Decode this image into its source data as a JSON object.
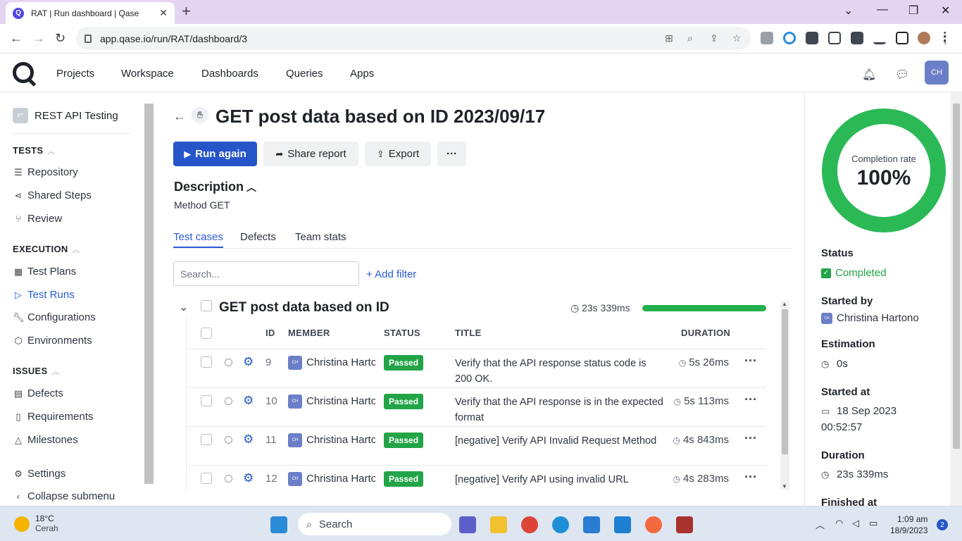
{
  "browser": {
    "tab_title": "RAT | Run dashboard | Qase",
    "tab_favicon": "Q",
    "url": "app.qase.io/run/RAT/dashboard/3"
  },
  "app": {
    "nav": [
      "Projects",
      "Workspace",
      "Dashboards",
      "Queries",
      "Apps"
    ],
    "user_initials": "CH"
  },
  "sidebar": {
    "project_badge": "RT",
    "project_name": "REST API Testing",
    "sections": {
      "tests": "TESTS",
      "execution": "EXECUTION",
      "issues": "ISSUES"
    },
    "items": [
      {
        "label": "Repository",
        "icon": "list-icon"
      },
      {
        "label": "Shared Steps",
        "icon": "share-icon"
      },
      {
        "label": "Review",
        "icon": "pull-request-icon"
      },
      {
        "label": "Test Plans",
        "icon": "table-icon"
      },
      {
        "label": "Test Runs",
        "icon": "play-icon"
      },
      {
        "label": "Configurations",
        "icon": "wrench-icon"
      },
      {
        "label": "Environments",
        "icon": "cube-icon"
      },
      {
        "label": "Defects",
        "icon": "defect-icon"
      },
      {
        "label": "Requirements",
        "icon": "document-icon"
      },
      {
        "label": "Milestones",
        "icon": "milestone-icon"
      },
      {
        "label": "Settings",
        "icon": "gear-icon"
      },
      {
        "label": "Collapse submenu",
        "icon": "chevron-left-icon"
      }
    ]
  },
  "run": {
    "title": "GET post data based on ID 2023/09/17",
    "buttons": {
      "run_again": "Run again",
      "share_report": "Share report",
      "export": "Export",
      "more": "···"
    },
    "description_heading": "Description",
    "description_text": "Method GET",
    "tabs": [
      "Test cases",
      "Defects",
      "Team stats"
    ],
    "search_placeholder": "Search...",
    "add_filter": "+ Add filter",
    "suite": {
      "name": "GET post data based on ID",
      "time": "23s 339ms",
      "progress": 1.0
    },
    "columns": {
      "id": "ID",
      "member": "MEMBER",
      "status": "STATUS",
      "title": "TITLE",
      "duration": "DURATION"
    },
    "rows": [
      {
        "id": "9",
        "member_initials": "CH",
        "member": "Christina Hartono",
        "status": "Passed",
        "title": "Verify that the API response status code is 200 OK.",
        "duration": "5s 26ms"
      },
      {
        "id": "10",
        "member_initials": "CH",
        "member": "Christina Hartono",
        "status": "Passed",
        "title": "Verify that the API response is in the expected format",
        "duration": "5s 113ms"
      },
      {
        "id": "11",
        "member_initials": "CH",
        "member": "Christina Hartono",
        "status": "Passed",
        "title": "[negative] Verify API Invalid Request Method",
        "duration": "4s 843ms"
      },
      {
        "id": "12",
        "member_initials": "CH",
        "member": "Christina Hartono",
        "status": "Passed",
        "title": "[negative] Verify API using invalid URL",
        "duration": "4s 283ms"
      }
    ]
  },
  "summary": {
    "completion_label": "Completion rate",
    "completion_value": "100%",
    "completion_fraction": 1.0,
    "status_label": "Status",
    "status_value": "Completed",
    "started_by_label": "Started by",
    "started_by_initials": "CH",
    "started_by_value": "Christina Hartono",
    "estimation_label": "Estimation",
    "estimation_value": "0s",
    "started_at_label": "Started at",
    "started_at_date": "18 Sep 2023",
    "started_at_time": "00:52:57",
    "duration_label": "Duration",
    "duration_value": "23s 339ms",
    "finished_at_label": "Finished at"
  },
  "taskbar": {
    "temp": "18°C",
    "weather": "Cerah",
    "search": "Search",
    "time": "1:09 am",
    "date": "18/9/2023",
    "notifications": "2"
  },
  "colors": {
    "accent": "#2655c9",
    "passed": "#22a447",
    "donut": "#2bb956"
  }
}
